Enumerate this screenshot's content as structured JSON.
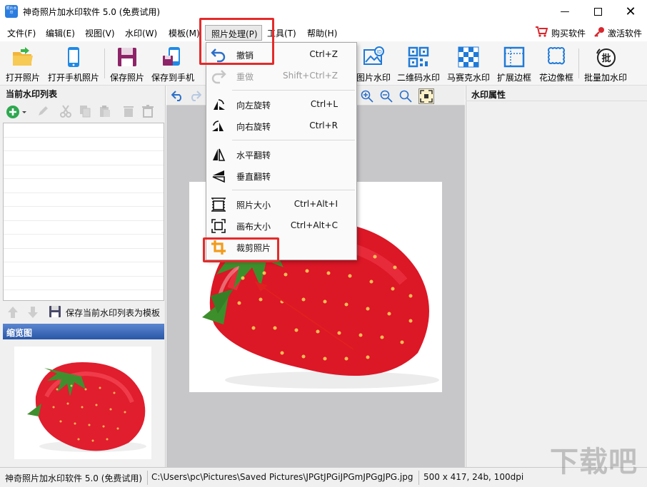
{
  "app": {
    "title": "神奇照片加水印软件 5.0 (免费试用)",
    "icon_text": "照片水印",
    "accent_color": "#2b7de0"
  },
  "menubar": {
    "items": [
      "文件(F)",
      "编辑(E)",
      "视图(V)",
      "水印(W)",
      "模板(M)",
      "照片处理(P)",
      "工具(T)",
      "帮助(H)"
    ],
    "buy": "购买软件",
    "activate": "激活软件"
  },
  "toolbar": {
    "buttons": [
      "打开照片",
      "打开手机照片",
      "保存照片",
      "保存到手机",
      "图片水印",
      "二维码水印",
      "马赛克水印",
      "扩展边框",
      "花边像框",
      "批量加水印"
    ]
  },
  "left_panel": {
    "list_title": "当前水印列表",
    "save_template": "保存当前水印列表为模板",
    "thumb_title": "缩览图"
  },
  "right_panel": {
    "title": "水印属性"
  },
  "dropdown": {
    "items": [
      {
        "label": "撤销",
        "shortcut": "Ctrl+Z",
        "icon": "undo-icon"
      },
      {
        "label": "重做",
        "shortcut": "Shift+Ctrl+Z",
        "icon": "redo-icon"
      },
      {
        "label": "向左旋转",
        "shortcut": "Ctrl+L",
        "icon": "rotate-left-icon"
      },
      {
        "label": "向右旋转",
        "shortcut": "Ctrl+R",
        "icon": "rotate-right-icon"
      },
      {
        "label": "水平翻转",
        "shortcut": "",
        "icon": "flip-horizontal-icon"
      },
      {
        "label": "垂直翻转",
        "shortcut": "",
        "icon": "flip-vertical-icon"
      },
      {
        "label": "照片大小",
        "shortcut": "Ctrl+Alt+I",
        "icon": "photo-size-icon"
      },
      {
        "label": "画布大小",
        "shortcut": "Ctrl+Alt+C",
        "icon": "canvas-size-icon"
      },
      {
        "label": "裁剪照片",
        "shortcut": "",
        "icon": "crop-icon"
      }
    ]
  },
  "statusbar": {
    "app_name": "神奇照片加水印软件 5.0 (免费试用)",
    "file_path": "C:\\Users\\pc\\Pictures\\Saved Pictures\\JPGtJPGiJPGmJPGgJPG.jpg",
    "image_info": "500 x 417, 24b, 100dpi"
  },
  "watermark_overlay": "下载吧"
}
